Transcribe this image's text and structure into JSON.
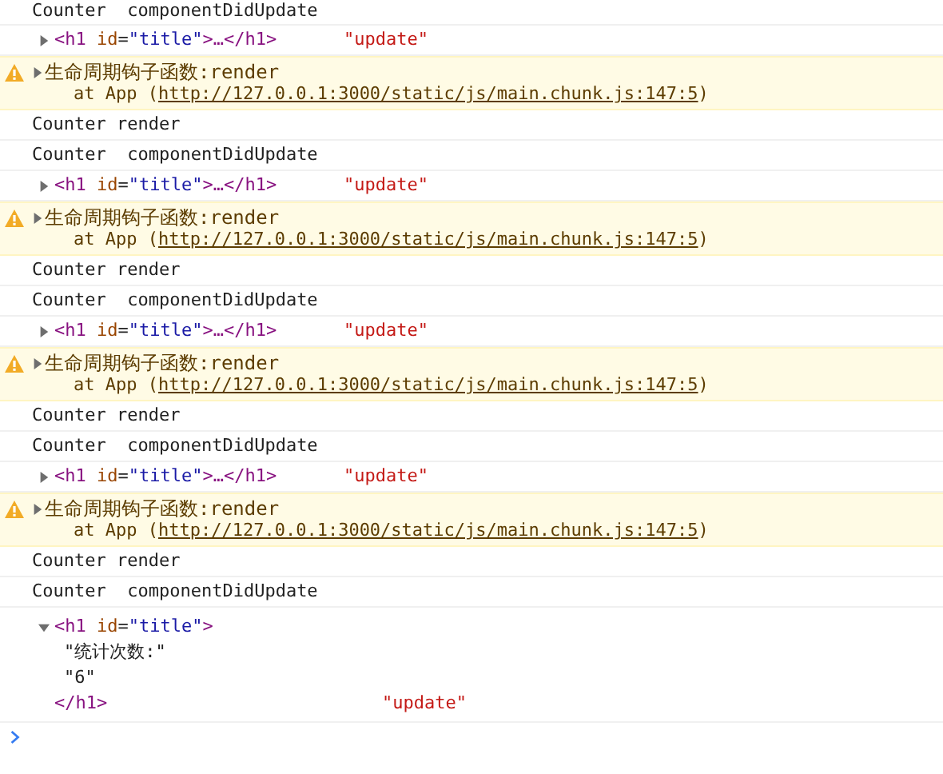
{
  "entries": [
    {
      "kind": "log",
      "text": "Counter  componentDidUpdate"
    },
    {
      "kind": "element",
      "expanded": false,
      "markup": [
        {
          "kind": "tag",
          "text": "<h1"
        },
        {
          "kind": "attr",
          "text": " id"
        },
        {
          "kind": "punct",
          "text": "="
        },
        {
          "kind": "value",
          "text": "\"title\""
        },
        {
          "kind": "tag",
          "text": ">…</h1>"
        }
      ],
      "arg": "\"update\""
    },
    {
      "kind": "warning",
      "expanded": false,
      "message": "生命周期钩子函数:render",
      "stack_prefix": "at App (",
      "link": "http://127.0.0.1:3000/static/js/main.chunk.js:147:5",
      "stack_suffix": ")"
    },
    {
      "kind": "log",
      "text": "Counter render"
    },
    {
      "kind": "log",
      "text": "Counter  componentDidUpdate"
    },
    {
      "kind": "element",
      "expanded": false,
      "markup": [
        {
          "kind": "tag",
          "text": "<h1"
        },
        {
          "kind": "attr",
          "text": " id"
        },
        {
          "kind": "punct",
          "text": "="
        },
        {
          "kind": "value",
          "text": "\"title\""
        },
        {
          "kind": "tag",
          "text": ">…</h1>"
        }
      ],
      "arg": "\"update\""
    },
    {
      "kind": "warning",
      "expanded": false,
      "message": "生命周期钩子函数:render",
      "stack_prefix": "at App (",
      "link": "http://127.0.0.1:3000/static/js/main.chunk.js:147:5",
      "stack_suffix": ")"
    },
    {
      "kind": "log",
      "text": "Counter render"
    },
    {
      "kind": "log",
      "text": "Counter  componentDidUpdate"
    },
    {
      "kind": "element",
      "expanded": false,
      "markup": [
        {
          "kind": "tag",
          "text": "<h1"
        },
        {
          "kind": "attr",
          "text": " id"
        },
        {
          "kind": "punct",
          "text": "="
        },
        {
          "kind": "value",
          "text": "\"title\""
        },
        {
          "kind": "tag",
          "text": ">…</h1>"
        }
      ],
      "arg": "\"update\""
    },
    {
      "kind": "warning",
      "expanded": false,
      "message": "生命周期钩子函数:render",
      "stack_prefix": "at App (",
      "link": "http://127.0.0.1:3000/static/js/main.chunk.js:147:5",
      "stack_suffix": ")"
    },
    {
      "kind": "log",
      "text": "Counter render"
    },
    {
      "kind": "log",
      "text": "Counter  componentDidUpdate"
    },
    {
      "kind": "element",
      "expanded": false,
      "markup": [
        {
          "kind": "tag",
          "text": "<h1"
        },
        {
          "kind": "attr",
          "text": " id"
        },
        {
          "kind": "punct",
          "text": "="
        },
        {
          "kind": "value",
          "text": "\"title\""
        },
        {
          "kind": "tag",
          "text": ">…</h1>"
        }
      ],
      "arg": "\"update\""
    },
    {
      "kind": "warning",
      "expanded": false,
      "message": "生命周期钩子函数:render",
      "stack_prefix": "at App (",
      "link": "http://127.0.0.1:3000/static/js/main.chunk.js:147:5",
      "stack_suffix": ")"
    },
    {
      "kind": "log",
      "text": "Counter render"
    },
    {
      "kind": "log",
      "text": "Counter  componentDidUpdate"
    },
    {
      "kind": "element",
      "expanded": true,
      "markup": [
        {
          "kind": "tag",
          "text": "<h1"
        },
        {
          "kind": "attr",
          "text": " id"
        },
        {
          "kind": "punct",
          "text": "="
        },
        {
          "kind": "value",
          "text": "\"title\""
        },
        {
          "kind": "tag",
          "text": ">"
        }
      ],
      "children": [
        "\"统计次数:\"",
        "\"6\""
      ],
      "closing": "</h1>",
      "arg": "\"update\""
    }
  ]
}
